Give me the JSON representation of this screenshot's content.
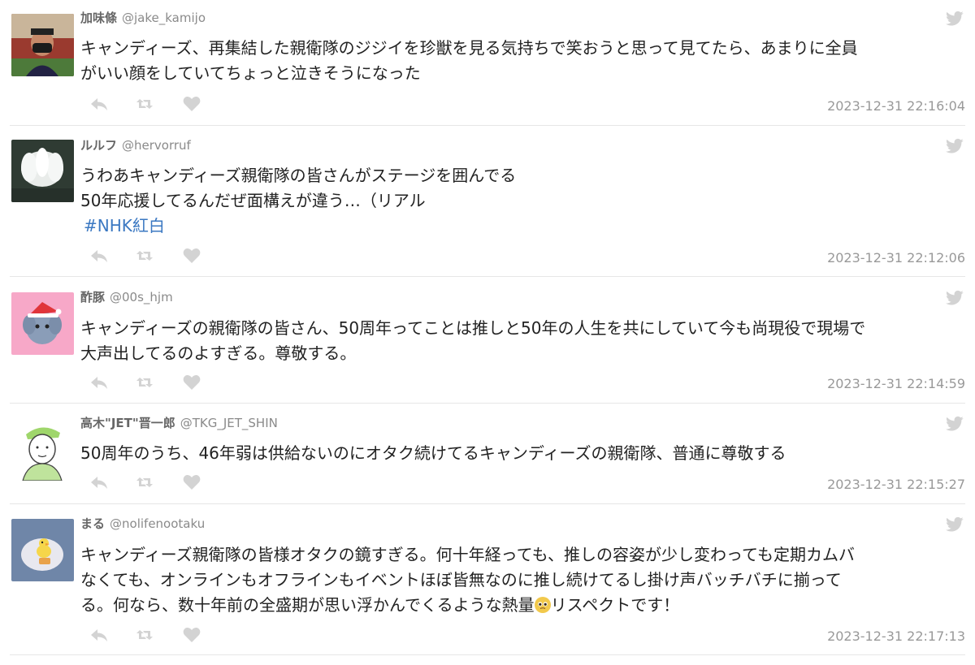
{
  "tweets": [
    {
      "name": "加味條",
      "handle": "@jake_kamijo",
      "lines": [
        "キャンディーズ、再集結した親衛隊のジジイを珍獣を見る気持ちで笑おうと思って見てたら、あまりに全員",
        "がいい顔をしていてちょっと泣きそうになった"
      ],
      "timestamp": "2023-12-31 22:16:04"
    },
    {
      "name": "ルルフ",
      "handle": "@hervorruf",
      "lines": [
        "うわあキャンディーズ親衛隊の皆さんがステージを囲んでる",
        "50年応援してるんだぜ面構えが違う…（リアル"
      ],
      "hashtag": "#NHK紅白",
      "timestamp": "2023-12-31 22:12:06"
    },
    {
      "name": "酢豚",
      "handle": "@00s_hjm",
      "lines": [
        "キャンディーズの親衛隊の皆さん、50周年ってことは推しと50年の人生を共にしていて今も尚現役で現場で",
        "大声出してるのよすぎる。尊敬する。"
      ],
      "timestamp": "2023-12-31 22:14:59"
    },
    {
      "name": "高木\"JET\"晋一郎",
      "handle": "@TKG_JET_SHIN",
      "lines": [
        "50周年のうち、46年弱は供給ないのにオタク続けてるキャンディーズの親衛隊、普通に尊敬する"
      ],
      "timestamp": "2023-12-31 22:15:27"
    },
    {
      "name": "まる",
      "handle": "@nolifenootaku",
      "lines": [
        "キャンディーズ親衛隊の皆様オタクの鏡すぎる。何十年経っても、推しの容姿が少し変わっても定期カムバ",
        "なくても、オンラインもオフラインもイベントほぼ皆無なのに推し続けてるし掛け声バッチバチに揃って",
        "る。何なら、数十年前の全盛期が思い浮かんでくるような熱量"
      ],
      "line3_suffix": "リスペクトです！",
      "timestamp": "2023-12-31 22:17:13"
    }
  ],
  "icons": {
    "service": "twitter-bird-icon",
    "reply": "reply-icon",
    "retweet": "retweet-icon",
    "like": "heart-icon",
    "emoji": "pleading-face-emoji"
  },
  "colors": {
    "hashtag": "#3b78c2",
    "muted": "#999999",
    "icon": "#d3d3d3",
    "divider": "#e6e6e6"
  }
}
